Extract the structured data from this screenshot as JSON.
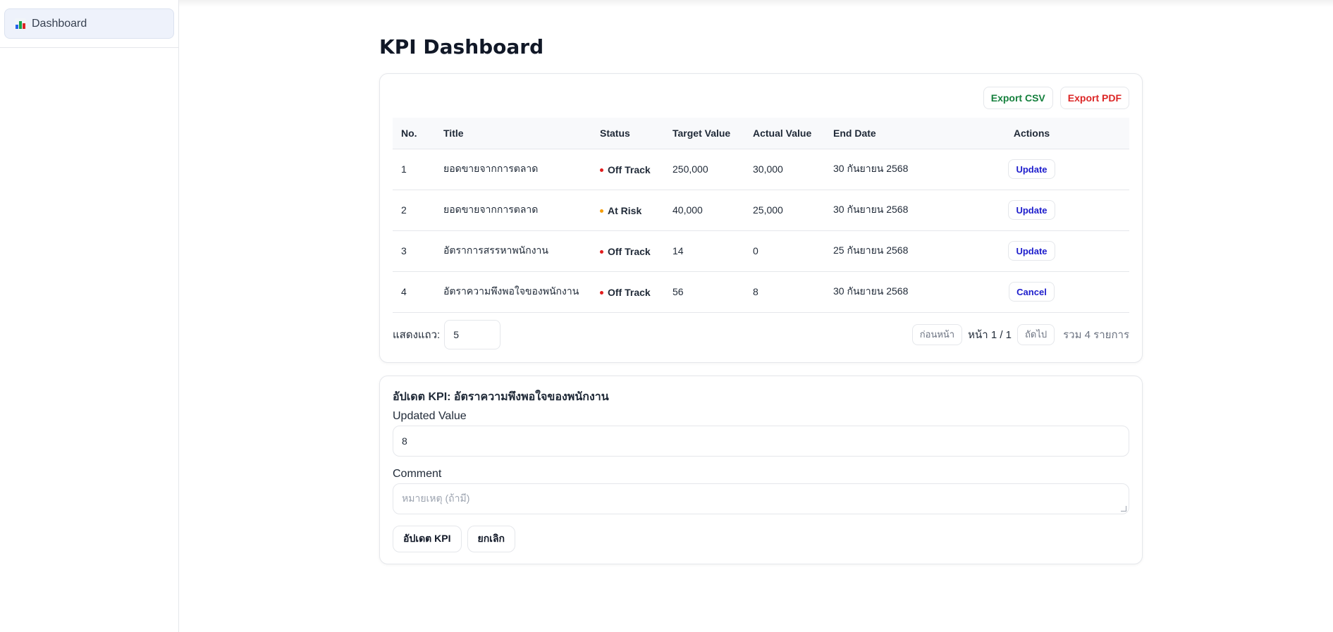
{
  "sidebar": {
    "items": [
      {
        "label": "Dashboard",
        "icon": "bar-chart-icon"
      }
    ]
  },
  "page": {
    "title": "KPI Dashboard"
  },
  "export": {
    "csv_label": "Export CSV",
    "pdf_label": "Export PDF"
  },
  "table": {
    "headers": {
      "no": "No.",
      "title": "Title",
      "status": "Status",
      "target": "Target Value",
      "actual": "Actual Value",
      "end": "End Date",
      "actions": "Actions"
    },
    "rows": [
      {
        "no": "1",
        "title": "ยอดขายจากการตลาด",
        "status": "Off Track",
        "status_color": "#e11d1d",
        "target": "250,000",
        "actual": "30,000",
        "end": "30 กันยายน 2568",
        "action": "Update"
      },
      {
        "no": "2",
        "title": "ยอดขายจากการตลาด",
        "status": "At Risk",
        "status_color": "#f59e0b",
        "target": "40,000",
        "actual": "25,000",
        "end": "30 กันยายน 2568",
        "action": "Update"
      },
      {
        "no": "3",
        "title": "อัตราการสรรหาพนักงาน",
        "status": "Off Track",
        "status_color": "#e11d1d",
        "target": "14",
        "actual": "0",
        "end": "25 กันยายน 2568",
        "action": "Update"
      },
      {
        "no": "4",
        "title": "อัตราความพึงพอใจของพนักงาน",
        "status": "Off Track",
        "status_color": "#e11d1d",
        "target": "56",
        "actual": "8",
        "end": "30 กันยายน 2568",
        "action": "Cancel"
      }
    ]
  },
  "pager": {
    "rows_label": "แสดงแถว:",
    "rows_value": "5",
    "prev_label": "ก่อนหน้า",
    "page_text": "หน้า 1 / 1",
    "next_label": "ถัดไป",
    "total_text": "รวม 4 รายการ"
  },
  "form": {
    "title": "อัปเดต KPI: อัตราความพึงพอใจของพนักงาน",
    "value_label": "Updated Value",
    "value": "8",
    "comment_label": "Comment",
    "comment_placeholder": "หมายเหตุ (ถ้ามี)",
    "submit_label": "อัปเดต KPI",
    "cancel_label": "ยกเลิก"
  }
}
